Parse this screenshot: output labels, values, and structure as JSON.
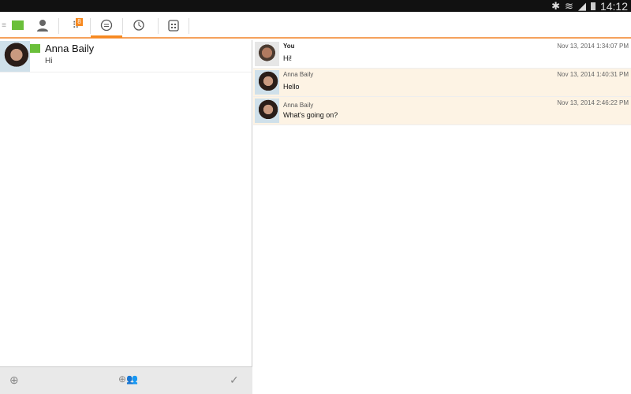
{
  "status_bar": {
    "time": "14:12"
  },
  "toolbar": {
    "dialpad_badge": "8",
    "active_tab": "chat"
  },
  "conversations": [
    {
      "name": "Anna Baily",
      "last_message": "Hi"
    }
  ],
  "messages": [
    {
      "sender": "You",
      "timestamp": "Nov 13, 2014 1:34:07 PM",
      "text": "Hi!",
      "mine": true
    },
    {
      "sender": "Anna Baily",
      "timestamp": "Nov 13, 2014 1:40:31 PM",
      "text": "Hello",
      "mine": false
    },
    {
      "sender": "Anna Baily",
      "timestamp": "Nov 13, 2014 2:46:22 PM",
      "text": "What's going on?",
      "mine": false
    }
  ],
  "colors": {
    "accent": "#f7891f",
    "other_bg": "#fdf3e4",
    "flag": "#6abf3a"
  }
}
